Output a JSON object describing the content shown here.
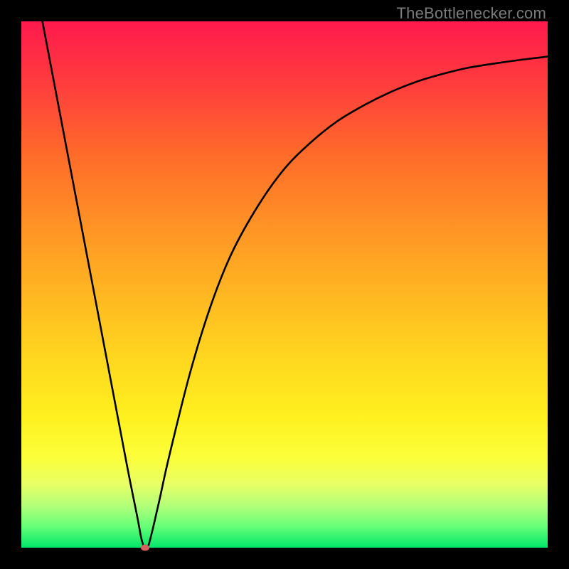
{
  "attribution": "TheBottlenecker.com",
  "chart_data": {
    "type": "line",
    "title": "",
    "xlabel": "",
    "ylabel": "",
    "xlim": [
      0,
      100
    ],
    "ylim": [
      0,
      100
    ],
    "series": [
      {
        "name": "bottleneck-curve",
        "x": [
          4,
          8,
          12,
          16,
          20,
          22,
          23,
          24,
          26,
          28,
          32,
          36,
          40,
          45,
          50,
          55,
          60,
          65,
          70,
          75,
          80,
          85,
          90,
          95,
          100
        ],
        "values": [
          100,
          79,
          58,
          37,
          16,
          6,
          1,
          0,
          8,
          17,
          33,
          46,
          56,
          65,
          72,
          77,
          81,
          84,
          86.5,
          88.5,
          90,
          91.2,
          92,
          92.7,
          93.3
        ]
      }
    ],
    "marker": {
      "x": 23.5,
      "y": 0
    },
    "gradient_stops": [
      {
        "pos": 0.0,
        "color": "#ff1a4d"
      },
      {
        "pos": 0.5,
        "color": "#ffd21f"
      },
      {
        "pos": 1.0,
        "color": "#00e66a"
      }
    ]
  }
}
